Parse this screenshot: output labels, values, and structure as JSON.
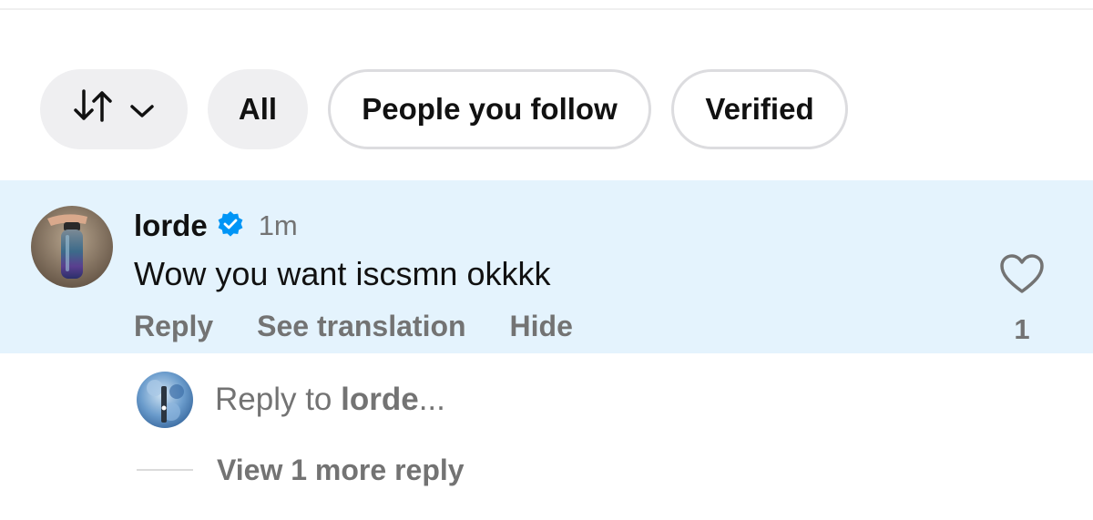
{
  "filters": {
    "sort_icon": "sort-arrows-icon",
    "chevron_icon": "chevron-down-icon",
    "all_label": "All",
    "people_you_follow_label": "People you follow",
    "verified_label": "Verified"
  },
  "comment": {
    "username": "lorde",
    "verified_icon": "verified-badge-icon",
    "time": "1m",
    "text": "Wow you want iscsmn okkkk",
    "actions": {
      "reply": "Reply",
      "see_translation": "See translation",
      "hide": "Hide"
    },
    "like_icon": "heart-icon",
    "like_count": "1",
    "highlight_color": "#e4f3fd"
  },
  "reply_box": {
    "prefix": "Reply to ",
    "target": "lorde",
    "suffix": "..."
  },
  "view_more": {
    "label": "View 1 more reply"
  },
  "colors": {
    "accent_verified": "#0095f6",
    "secondary_text": "#737373"
  }
}
